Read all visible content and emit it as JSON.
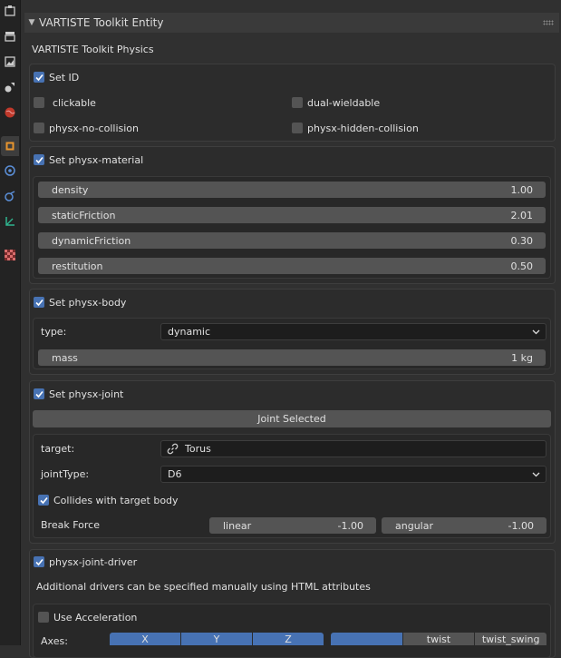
{
  "panel": {
    "title": "VARTISTE Toolkit Entity",
    "subtitle": "VARTISTE Toolkit Physics"
  },
  "tabs": [
    {
      "icon": "tool-icon"
    },
    {
      "icon": "render-icon"
    },
    {
      "icon": "output-icon"
    },
    {
      "icon": "view-layer-icon"
    },
    {
      "icon": "scene-icon"
    },
    {
      "icon": "world-icon"
    },
    {
      "icon": "object-icon"
    },
    {
      "icon": "physics-icon"
    },
    {
      "icon": "constraint-icon"
    },
    {
      "icon": "object-data-icon"
    },
    {
      "icon": "texture-icon"
    }
  ],
  "set_id": {
    "label": "Set ID",
    "checked": true,
    "options": [
      {
        "label": "clickable",
        "checked": false
      },
      {
        "label": "dual-wieldable",
        "checked": false
      },
      {
        "label": "physx-no-collision",
        "checked": false
      },
      {
        "label": "physx-hidden-collision",
        "checked": false
      }
    ]
  },
  "material": {
    "label": "Set physx-material",
    "checked": true,
    "fields": [
      {
        "label": "density",
        "value": "1.00"
      },
      {
        "label": "staticFriction",
        "value": "2.01"
      },
      {
        "label": "dynamicFriction",
        "value": "0.30"
      },
      {
        "label": "restitution",
        "value": "0.50"
      }
    ]
  },
  "body": {
    "label": "Set physx-body",
    "checked": true,
    "type_label": "type:",
    "type_value": "dynamic",
    "mass_label": "mass",
    "mass_value": "1 kg"
  },
  "joint": {
    "label": "Set physx-joint",
    "checked": true,
    "button": "Joint Selected",
    "target_label": "target:",
    "target_value": "Torus",
    "joint_type_label": "jointType:",
    "joint_type_value": "D6",
    "collides_label": "Collides with target body",
    "collides_checked": true,
    "break_force_label": "Break Force",
    "linear_label": "linear",
    "linear_value": "-1.00",
    "angular_label": "angular",
    "angular_value": "-1.00"
  },
  "driver": {
    "label": "physx-joint-driver",
    "checked": true,
    "note": "Additional drivers can be specified manually using HTML attributes",
    "accel_label": "Use Acceleration",
    "accel_checked": false,
    "axes_label": "Axes:",
    "axes": [
      "X",
      "Y",
      "Z"
    ],
    "modes": [
      "",
      "twist",
      "twist_swing"
    ]
  },
  "colors": {
    "accent": "#4772b3",
    "background": "#303030",
    "field": "#545454"
  }
}
